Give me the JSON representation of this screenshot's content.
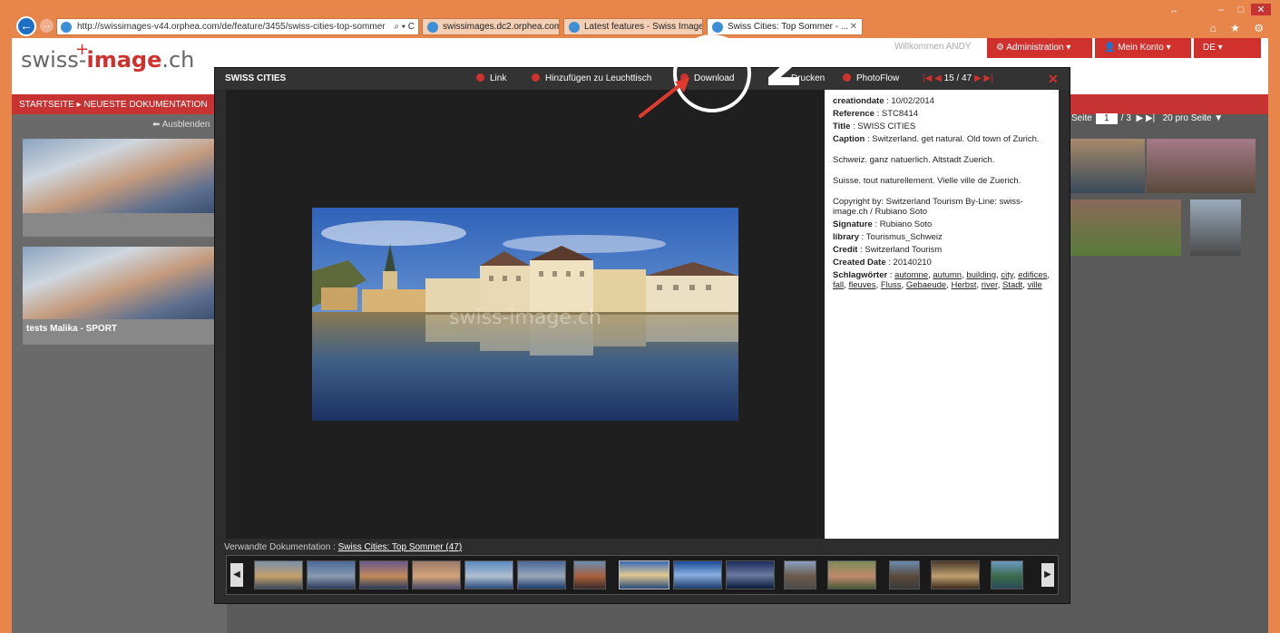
{
  "browser": {
    "address": "http://swissimages-v44.orphea.com/de/feature/3455/swiss-cities-top-sommer",
    "address_controls": "⌕ ▾ C",
    "tabs": [
      {
        "label": "swissimages.dc2.orphea.com"
      },
      {
        "label": "Latest features - Swiss Image"
      },
      {
        "label": "Swiss Cities: Top Sommer - ..."
      }
    ],
    "nav_icons": "⌂ ★ ⚙"
  },
  "site": {
    "logo_prefix": "swiss-",
    "logo_bold": "image",
    "logo_suffix": ".ch",
    "welcome": "Willkommen ANDY",
    "admin_menu": "⚙ Administration ▾",
    "account_menu": "👤 Mein Konto ▾",
    "lang_menu": "DE ▾",
    "breadcrumb_home": "STARTSEITE",
    "breadcrumb_current": "NEUESTE DOKUMENTATION",
    "hide_label": "⬅ Ausblenden",
    "card2_caption": "tests Malika - SPORT",
    "pager_prefix": "Seite",
    "pager_page": "1",
    "pager_total": "/ 3",
    "per_page": "20 pro Seite ▼"
  },
  "lightbox": {
    "title": "SWISS CITIES",
    "tools": {
      "link": "Link",
      "lighttable": "Hinzufügen zu Leuchttisch",
      "download": "Download",
      "print": "Drucken",
      "photoflow": "PhotoFlow"
    },
    "position": "15 / 47",
    "info": {
      "creationdate_label": "creationdate",
      "creationdate": "10/02/2014",
      "reference_label": "Reference",
      "reference": "STC8414",
      "title_label": "Title",
      "title": "SWISS CITIES",
      "caption_label": "Caption",
      "caption": "Switzerland. get natural. Old town of Zurich.",
      "caption_de": "Schweiz. ganz natuerlich. Altstadt Zuerich.",
      "caption_fr": "Suisse. tout naturellement. Vielle ville de Zuerich.",
      "copyright": "Copyright by: Switzerland Tourism By-Line: swiss-image.ch / Rubiano Soto",
      "signature_label": "Signature",
      "signature": "Rubiano Soto",
      "library_label": "library",
      "library": "Tourismus_Schweiz",
      "credit_label": "Credit",
      "credit": "Switzerland Tourism",
      "created_label": "Created Date",
      "created": "20140210",
      "keywords_label": "Schlagwörter",
      "keywords": [
        "automne",
        "autumn",
        "building",
        "city",
        "edifices",
        "fall",
        "fleuves",
        "Fluss",
        "Gebaeude",
        "Herbst",
        "river",
        "Stadt",
        "ville"
      ]
    },
    "related_label": "Verwandte Dokumentation :",
    "related_link": "Swiss Cities: Top Sommer (47)",
    "watermark": "swiss-image.ch"
  },
  "annotation": {
    "step_number": "2"
  },
  "colors": {
    "brand_red": "#d0312d",
    "chrome_orange": "#e8854a"
  }
}
